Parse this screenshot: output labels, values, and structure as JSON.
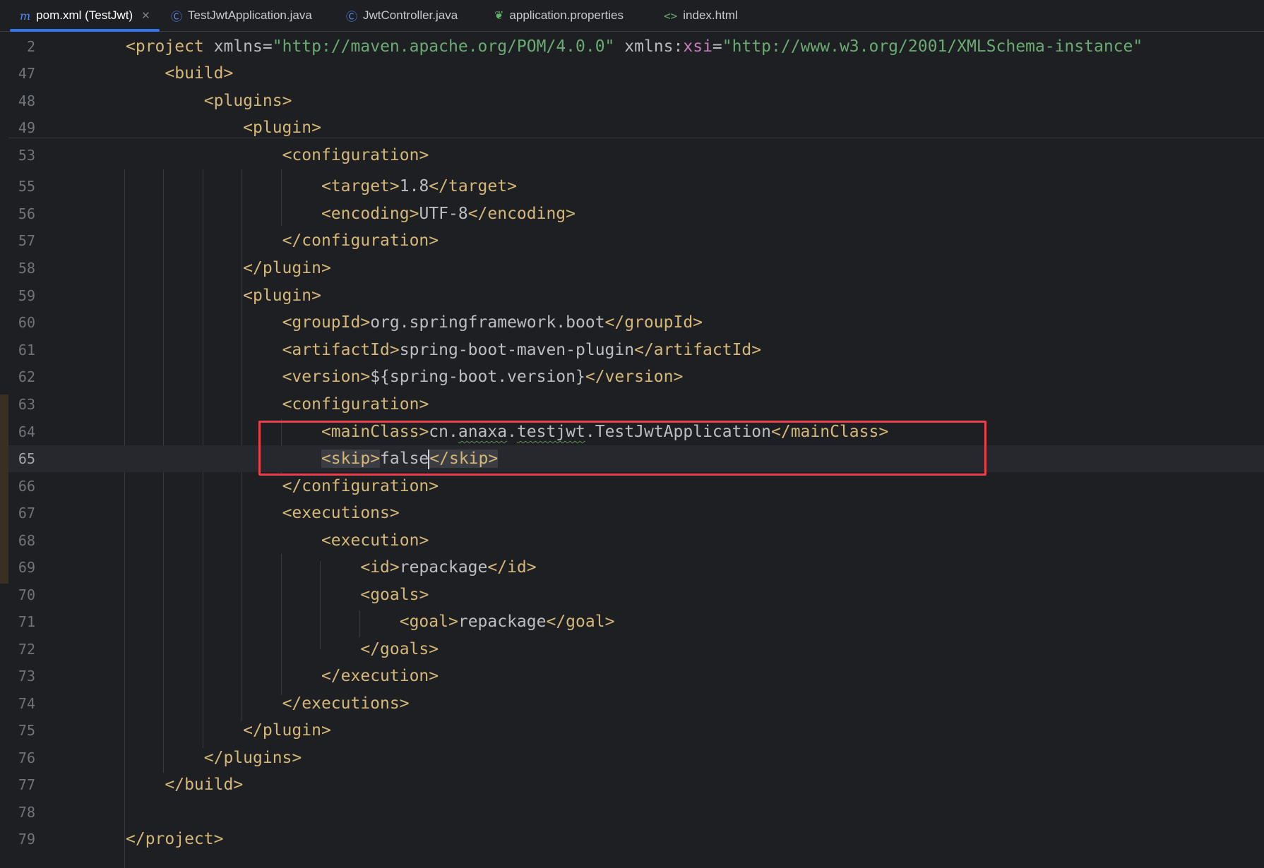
{
  "tabs": [
    {
      "label": "pom.xml (TestJwt)",
      "icon": "maven-m-icon",
      "active": true,
      "closable": true
    },
    {
      "label": "TestJwtApplication.java",
      "icon": "spring-class-icon"
    },
    {
      "label": "JwtController.java",
      "icon": "class-c-icon"
    },
    {
      "label": "application.properties",
      "icon": "spring-leaf-icon"
    },
    {
      "label": "index.html",
      "icon": "html-tag-icon"
    }
  ],
  "editor": {
    "current_line": "65",
    "lines": [
      {
        "n": "2",
        "text": "<project xmlns=\"http://maven.apache.org/POM/4.0.0\" xmlns:xsi=\"http://www.w3.org/2001/XMLSchema-instance\""
      },
      {
        "n": "47",
        "text": "    <build>"
      },
      {
        "n": "48",
        "text": "        <plugins>"
      },
      {
        "n": "49",
        "text": "            <plugin>"
      },
      {
        "n": "53",
        "text": "                <configuration>"
      },
      {
        "n": "55",
        "text": "                    <target>1.8</target>"
      },
      {
        "n": "56",
        "text": "                    <encoding>UTF-8</encoding>"
      },
      {
        "n": "57",
        "text": "                </configuration>"
      },
      {
        "n": "58",
        "text": "            </plugin>"
      },
      {
        "n": "59",
        "text": "            <plugin>"
      },
      {
        "n": "60",
        "text": "                <groupId>org.springframework.boot</groupId>"
      },
      {
        "n": "61",
        "text": "                <artifactId>spring-boot-maven-plugin</artifactId>"
      },
      {
        "n": "62",
        "text": "                <version>${spring-boot.version}</version>"
      },
      {
        "n": "63",
        "text": "                <configuration>"
      },
      {
        "n": "64",
        "text": "                    <mainClass>cn.anaxa.testjwt.TestJwtApplication</mainClass>"
      },
      {
        "n": "65",
        "text": "                    <skip>false</skip>"
      },
      {
        "n": "66",
        "text": "                </configuration>"
      },
      {
        "n": "67",
        "text": "                <executions>"
      },
      {
        "n": "68",
        "text": "                    <execution>"
      },
      {
        "n": "69",
        "text": "                        <id>repackage</id>"
      },
      {
        "n": "70",
        "text": "                        <goals>"
      },
      {
        "n": "71",
        "text": "                            <goal>repackage</goal>"
      },
      {
        "n": "72",
        "text": "                        </goals>"
      },
      {
        "n": "73",
        "text": "                    </execution>"
      },
      {
        "n": "74",
        "text": "                </executions>"
      },
      {
        "n": "75",
        "text": "            </plugin>"
      },
      {
        "n": "76",
        "text": "        </plugins>"
      },
      {
        "n": "77",
        "text": "    </build>"
      },
      {
        "n": "78",
        "text": ""
      },
      {
        "n": "79",
        "text": "</project>"
      }
    ]
  },
  "colors": {
    "background": "#1e1f22",
    "tag": "#d5b778",
    "string": "#6aab73",
    "namespace": "#c77dbb",
    "highlight_box": "#e8414b",
    "tab_underline": "#3574f0"
  }
}
